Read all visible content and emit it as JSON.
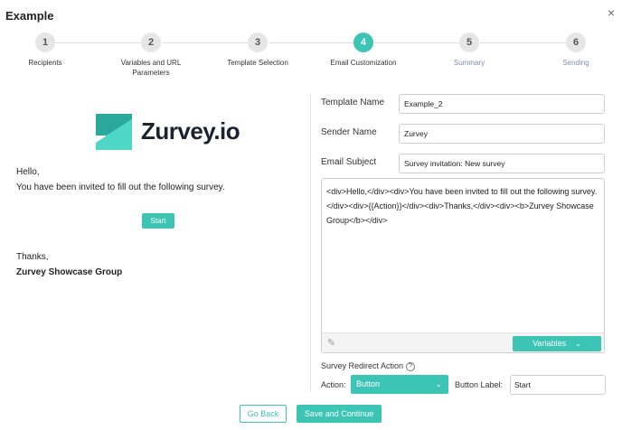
{
  "window": {
    "title": "Example",
    "close_icon": "×"
  },
  "stepper": {
    "steps": [
      {
        "num": "1",
        "label": "Recipients",
        "state": "done"
      },
      {
        "num": "2",
        "label": "Variables and URL Parameters",
        "state": "done"
      },
      {
        "num": "3",
        "label": "Template Selection",
        "state": "done"
      },
      {
        "num": "4",
        "label": "Email Customization",
        "state": "active"
      },
      {
        "num": "5",
        "label": "Summary",
        "state": "pending"
      },
      {
        "num": "6",
        "label": "Sending",
        "state": "pending"
      }
    ]
  },
  "preview": {
    "logo_text": "Zurvey.io",
    "greeting_line1": "Hello,",
    "greeting_line2": "You have been invited to fill out the following survey.",
    "start_label": "Start",
    "thanks_line": "Thanks,",
    "signature": "Zurvey Showcase Group"
  },
  "form": {
    "template_name_label": "Template Name",
    "template_name_value": "Example_2",
    "sender_name_label": "Sender Name",
    "sender_name_value": "Zurvey",
    "email_subject_label": "Email Subject",
    "email_subject_value": "Survey invitation: New survey",
    "body_html": "<div>Hello,</div><div>You have been invited to fill out the following survey.</div><div>{{Action}}</div><div>Thanks,</div><div><b>Zurvey Showcase Group</b></div>",
    "variables_label": "Variables",
    "redirect_title": "Survey Redirect Action",
    "action_label": "Action:",
    "action_value": "Button",
    "button_label_label": "Button Label:",
    "button_label_value": "Start"
  },
  "footer": {
    "go_back_label": "Go Back",
    "save_continue_label": "Save and Continue"
  },
  "colors": {
    "accent": "#3cc4b5",
    "pending_step_text": "#7b8eb3"
  }
}
